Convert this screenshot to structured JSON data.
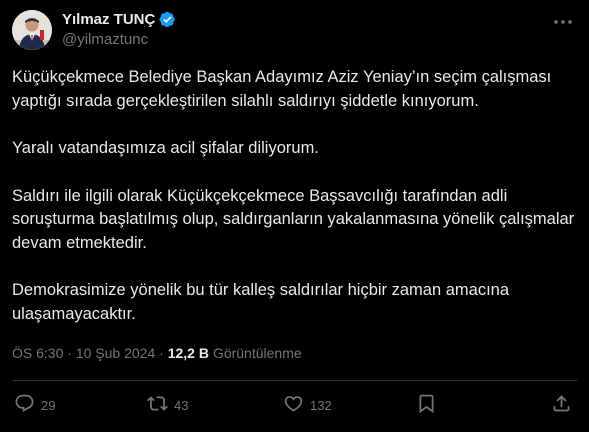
{
  "author": {
    "display_name": "Yılmaz TUNÇ",
    "handle": "@yilmaztunc",
    "verified": true
  },
  "icons": {
    "verified": "verified-badge-icon",
    "more": "more-icon",
    "reply": "reply-icon",
    "repost": "repost-icon",
    "like": "like-icon",
    "bookmark": "bookmark-icon",
    "share": "share-icon"
  },
  "tweet": {
    "paragraphs": [
      "Küçükçekmece Belediye Başkan Adayımız Aziz Yeniay’ın seçim çalışması yaptığı sırada gerçekleştirilen silahlı saldırıyı şiddetle kınıyorum.",
      "Yaralı vatandaşımıza acil şifalar diliyorum.",
      "Saldırı ile ilgili olarak Küçükçekçekmece Başsavcılığı tarafından adli soruşturma başlatılmış olup, saldırganların yakalanmasına yönelik çalışmalar devam etmektedir.",
      "Demokrasimize yönelik bu tür kalleş saldırılar hiçbir zaman amacına ulaşamayacaktır."
    ]
  },
  "meta": {
    "time": "ÖS 6:30",
    "separator": " · ",
    "date": "10 Şub 2024",
    "views": "12,2 B",
    "views_label": "Görüntülenme"
  },
  "actions": {
    "replies": "29",
    "reposts": "43",
    "likes": "132"
  },
  "colors": {
    "background": "#000000",
    "text": "#e7e9ea",
    "secondary": "#71767b",
    "verified": "#1d9bf0",
    "divider": "#2f3336"
  }
}
